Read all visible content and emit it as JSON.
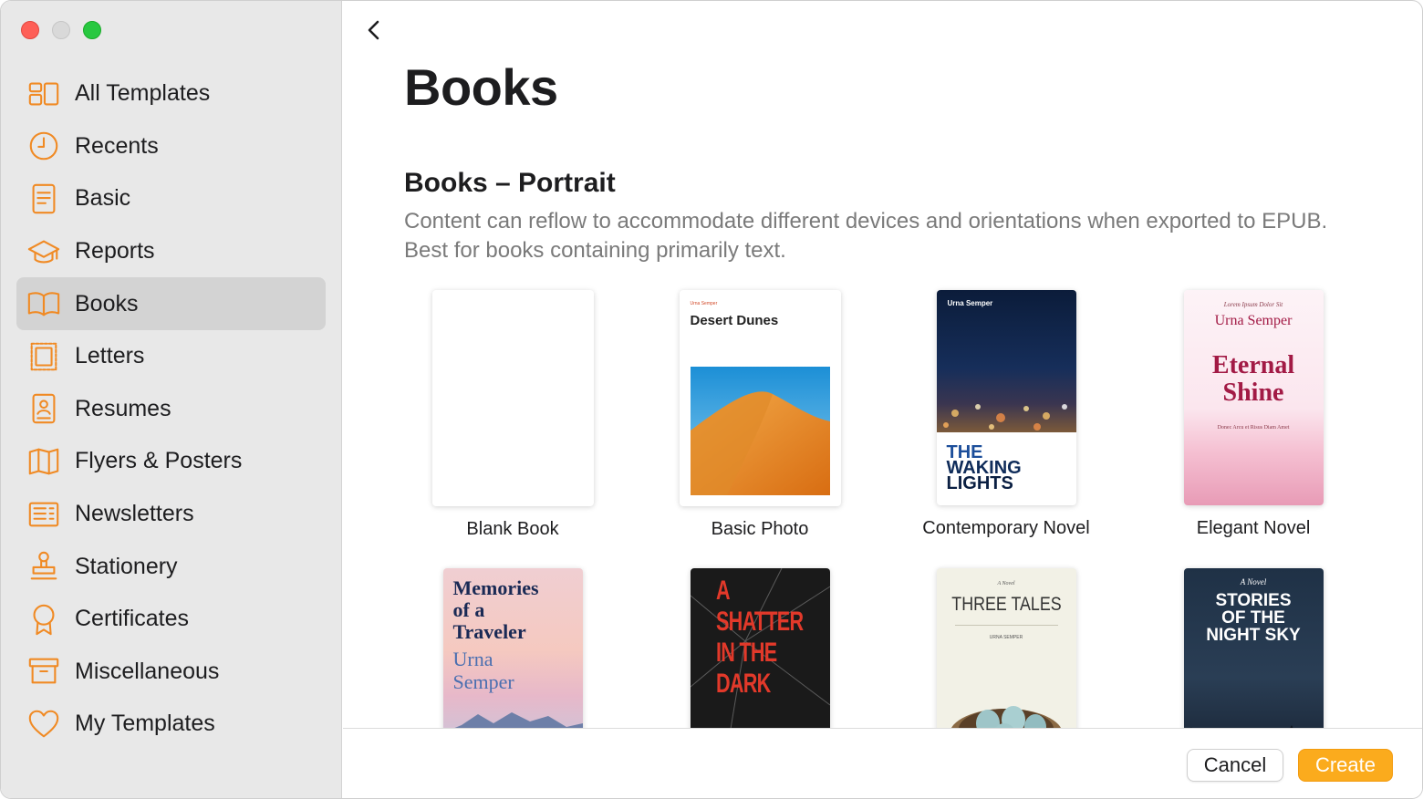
{
  "window": {
    "controls": [
      "close",
      "minimize",
      "maximize"
    ]
  },
  "sidebar": {
    "items": [
      {
        "label": "All Templates",
        "icon": "grid-icon"
      },
      {
        "label": "Recents",
        "icon": "clock-icon"
      },
      {
        "label": "Basic",
        "icon": "document-icon"
      },
      {
        "label": "Reports",
        "icon": "graduation-cap-icon"
      },
      {
        "label": "Books",
        "icon": "open-book-icon",
        "selected": true
      },
      {
        "label": "Letters",
        "icon": "stamp-frame-icon"
      },
      {
        "label": "Resumes",
        "icon": "person-document-icon"
      },
      {
        "label": "Flyers & Posters",
        "icon": "folded-map-icon"
      },
      {
        "label": "Newsletters",
        "icon": "newspaper-icon"
      },
      {
        "label": "Stationery",
        "icon": "rubber-stamp-icon"
      },
      {
        "label": "Certificates",
        "icon": "ribbon-icon"
      },
      {
        "label": "Miscellaneous",
        "icon": "archive-box-icon"
      },
      {
        "label": "My Templates",
        "icon": "heart-icon"
      }
    ]
  },
  "main": {
    "page_title": "Books",
    "section_title": "Books – Portrait",
    "section_description": "Content can reflow to accommodate different devices and orientations when exported to EPUB. Best for books containing primarily text.",
    "templates": [
      {
        "name": "Blank Book",
        "cover": {}
      },
      {
        "name": "Basic Photo",
        "cover": {
          "author": "Urna Semper",
          "title": "Desert Dunes"
        }
      },
      {
        "name": "Contemporary Novel",
        "cover": {
          "author": "Urna Semper",
          "title_lines": [
            "THE",
            "WAKING",
            "LIGHTS"
          ]
        }
      },
      {
        "name": "Elegant Novel",
        "cover": {
          "kicker": "Lorem Ipsum Dolor Sit",
          "author": "Urna Semper",
          "title_lines": [
            "Eternal",
            "Shine"
          ],
          "footer": "Donec Arcu et Risus Diam Amet"
        }
      },
      {
        "name": "",
        "cover": {
          "title_lines": [
            "Memories",
            "of a",
            "Traveler"
          ],
          "author_lines": [
            "Urna",
            "Semper"
          ]
        }
      },
      {
        "name": "",
        "cover": {
          "title_lines": [
            "A",
            "SHATTER",
            "IN THE",
            "DARK"
          ]
        }
      },
      {
        "name": "",
        "cover": {
          "kicker": "A Novel",
          "title": "THREE TALES",
          "author": "URNA SEMPER"
        }
      },
      {
        "name": "",
        "cover": {
          "kicker": "A Novel",
          "title_lines": [
            "STORIES",
            "OF THE",
            "NIGHT SKY"
          ]
        }
      }
    ]
  },
  "footer": {
    "cancel_label": "Cancel",
    "create_label": "Create"
  },
  "colors": {
    "accent": "#f08a24",
    "create_button": "#fbab1d",
    "sidebar_bg": "#e8e8e8",
    "selected_row": "#d3d3d3"
  }
}
